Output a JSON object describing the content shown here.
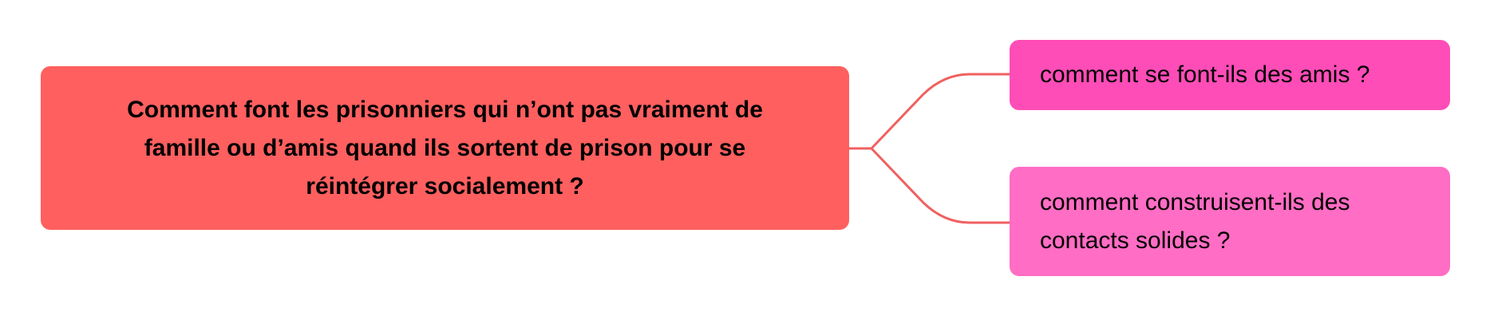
{
  "mindmap": {
    "root": {
      "label": "Comment font les prisonniers qui n’ont pas vraiment de famille ou d’amis quand ils sortent de prison pour se réintégrer socialement ?",
      "color": "#FF5F5F"
    },
    "children": [
      {
        "label": "comment se font-ils des amis ?",
        "color": "#FF4DB8"
      },
      {
        "label": "comment construisent-ils des contacts solides ?",
        "color": "#FF6DC4"
      }
    ],
    "connector_color": "#F06060"
  }
}
